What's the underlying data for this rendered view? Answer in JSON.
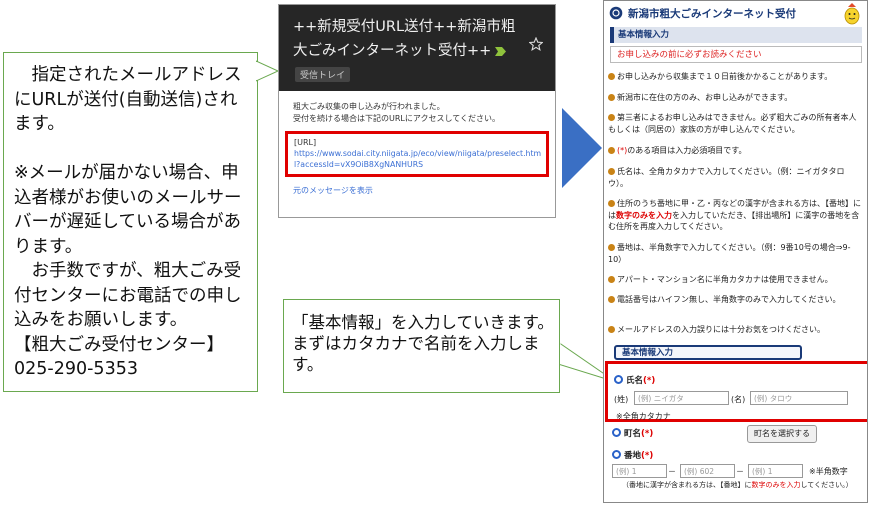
{
  "left_callout": {
    "text": "　指定されたメールアドレスにURLが送付(自動送信)されます。\n\n※メールが届かない場合、申込者様がお使いのメールサーバーが遅延している場合があります。\n　お手数ですが、粗大ごみ受付センターにお電話での申し込みをお願いします。\n【粗大ごみ受付センター】\n025-290-5353"
  },
  "email": {
    "subject": "++新規受付URL送付++新潟市粗大ごみインターネット受付++",
    "tag": "受信トレイ",
    "body_line1": "粗大ごみ収集の申し込みが行われました。",
    "body_line2": "受付を続ける場合は下記のURLにアクセスしてください。",
    "url_label": "[URL]",
    "url": "https://www.sodai.city.niigata.jp/eco/view/niigata/preselect.html?accessId=vX9OiB8XgNANHURS",
    "show_original": "元のメッセージを表示",
    "icons": [
      "star-icon",
      "importance-arrow-icon"
    ]
  },
  "bottom_callout": {
    "text": "「基本情報」を入力していきます。まずはカタカナで名前を入力します。"
  },
  "form": {
    "title": "新潟市粗大ごみインターネット受付",
    "section": "基本情報入力",
    "read_first": "お申し込みの前に必ずお読みください",
    "notes": [
      "お申し込みから収集まで１０日前後かかることがあります。",
      "新潟市に在住の方のみ、お申し込みができます。",
      "第三者によるお申し込みはできません。必ず粗大ごみの所有者本人もしくは（同居の）家族の方が申し込んでください。",
      "のある項目は入力必須項目です。",
      "氏名は、全角カタカナで入力してください。（例：ニイガタタロウ）。",
      "住所のうち番地に甲・乙・丙などの漢字が含まれる方は、【番地】には",
      "を入力していただき、【排出場所】に漢字の番地を含む住所を再度入力してください。",
      "番地は、半角数字で入力してください。（例：9番10号の場合⇒9-10）",
      "アパート・マンション名に半角カタカナは使用できません。",
      "電話番号はハイフン無し、半角数字のみで入力してください。",
      "メールアドレスの入力誤りには十分お気をつけください。"
    ],
    "req_mark": "(*)",
    "num_only": "数字のみを入力",
    "basic_info_button": "基本情報入力",
    "name_label": "氏名",
    "sei_label": "(姓)",
    "mei_label": "(名)",
    "sei_placeholder": "(例) ニイガタ",
    "mei_placeholder": "(例) タロウ",
    "kana_note": "※全角カタカナ",
    "town_label": "町名",
    "town_button": "町名を選択する",
    "banchi_label": "番地",
    "banchi_ph1": "(例) 1",
    "banchi_ph2": "(例) 602",
    "banchi_ph3": "(例) 1",
    "dash": "－",
    "halfwidth_note": "※半角数字",
    "banchi_note_a": "（番地に漢字が含まれる方は、【番地】に",
    "banchi_note_b": "してください。）",
    "colors": {
      "accent": "#1a3a78",
      "highlight_red": "#e00000",
      "callout_border": "#6aa84f",
      "arrow": "#3a6fc4"
    }
  }
}
